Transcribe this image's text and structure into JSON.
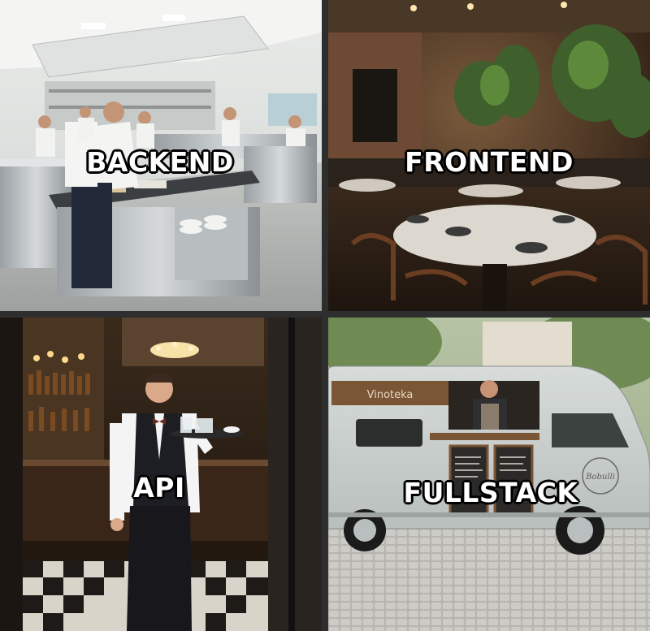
{
  "meme": {
    "panels": [
      {
        "caption": "BACKEND",
        "scene": "restaurant kitchen with chefs"
      },
      {
        "caption": "FRONTEND",
        "scene": "restaurant dining room"
      },
      {
        "caption": "API",
        "scene": "waiter carrying a tray"
      },
      {
        "caption": "FULLSTACK",
        "scene": "food truck with one cook"
      }
    ],
    "truck_sign": "Vinoteka",
    "truck_logo": "Bobulli"
  },
  "colors": {
    "divider": "#2e2e2e",
    "caption_fill": "#ffffff",
    "caption_outline": "#000000"
  }
}
